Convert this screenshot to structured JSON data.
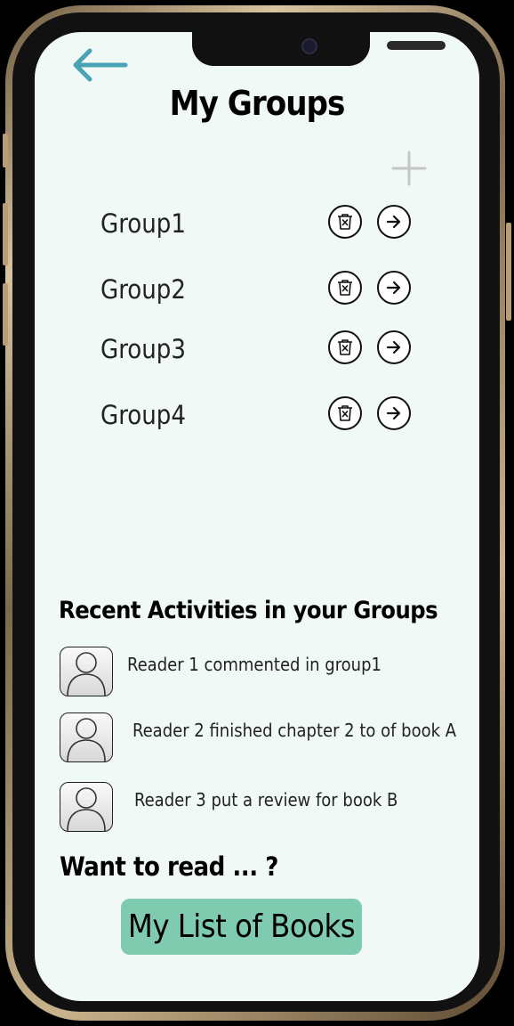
{
  "header": {
    "title": "My Groups"
  },
  "icons": {
    "back": "arrow-left-icon",
    "add": "plus-icon",
    "delete": "trash-x-icon",
    "open": "arrow-right-icon",
    "avatar": "user-icon"
  },
  "colors": {
    "screen_background": "#f1f9f7",
    "back_arrow": "#4aa3b5",
    "books_button": "#7ecbb0"
  },
  "groups": [
    {
      "label": "Group1"
    },
    {
      "label": "Group2"
    },
    {
      "label": "Group3"
    },
    {
      "label": "Group4"
    }
  ],
  "activities": {
    "heading": "Recent Activities in your Groups",
    "items": [
      {
        "text": "Reader 1 commented in group1"
      },
      {
        "text": "Reader 2 finished chapter 2 to of book A"
      },
      {
        "text": "Reader 3 put a review for book B"
      }
    ]
  },
  "footer": {
    "want_to_read": "Want to read ... ?",
    "books_button": "My List of Books"
  }
}
